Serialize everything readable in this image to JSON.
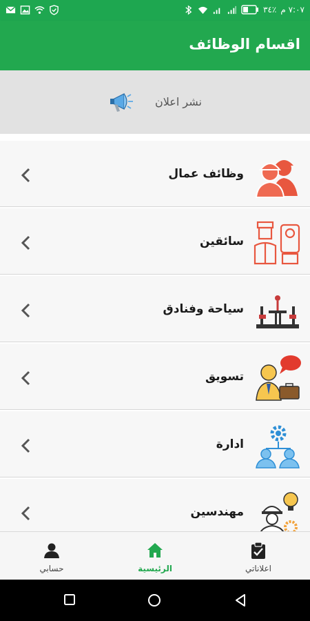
{
  "status_bar": {
    "time": "٧:٠٧ م",
    "battery_text": "٣٤٪",
    "left_icons": [
      "gmail-icon",
      "gallery-icon",
      "wifi-signal-icon",
      "shield-icon"
    ],
    "right_icons": [
      "bluetooth-icon",
      "wifi-icon",
      "signal-icon",
      "signal-icon",
      "battery-icon"
    ]
  },
  "app_bar": {
    "title": "اقسام الوظائف"
  },
  "post_ad": {
    "label": "نشر اعلان",
    "icon": "megaphone-icon"
  },
  "categories": [
    {
      "label": "وظائف عمال",
      "icon": "workers-icon"
    },
    {
      "label": "سائقين",
      "icon": "drivers-icon"
    },
    {
      "label": "سياحة وفنادق",
      "icon": "hotel-icon"
    },
    {
      "label": "تسويق",
      "icon": "marketing-icon"
    },
    {
      "label": "ادارة",
      "icon": "management-icon"
    },
    {
      "label": "مهندسين",
      "icon": "engineers-icon"
    }
  ],
  "bottom_nav": {
    "items": [
      {
        "label": "حسابي",
        "icon": "person-icon"
      },
      {
        "label": "الرئيسية",
        "icon": "home-icon",
        "active": true
      },
      {
        "label": "اعلاناتي",
        "icon": "clipboard-check-icon"
      }
    ]
  },
  "colors": {
    "primary": "#22a84f",
    "accent_icon": "#e8573f"
  }
}
